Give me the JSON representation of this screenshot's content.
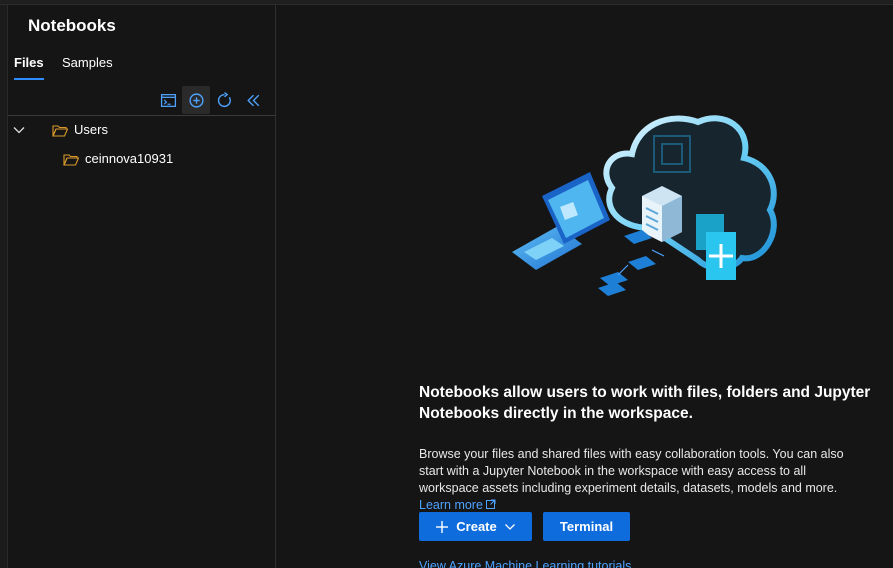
{
  "sidebar": {
    "title": "Notebooks",
    "tabs": [
      {
        "label": "Files",
        "active": true
      },
      {
        "label": "Samples",
        "active": false
      }
    ],
    "toolbar": {
      "icons": [
        "terminal-icon",
        "add-icon",
        "refresh-icon",
        "collapse-icon"
      ]
    },
    "tree": [
      {
        "label": "Users",
        "expanded": true,
        "icon": "folder-icon"
      },
      {
        "label": "ceinnova10931",
        "icon": "folder-icon"
      }
    ]
  },
  "main": {
    "headline": "Notebooks allow users to work with files, folders and Jupyter Notebooks directly in the workspace.",
    "description": "Browse your files and shared files with easy collaboration tools. You can also start with a Jupyter Notebook in the workspace with easy access to all workspace assets including experiment details, datasets, models and more.",
    "learn_more": "Learn more",
    "create_label": "Create",
    "terminal_label": "Terminal",
    "tutorial_link": "View Azure Machine Learning tutorials"
  },
  "colors": {
    "accent": "#0f6cdc",
    "link": "#4da3ff",
    "folder": "#d99a2b",
    "background": "#151515"
  }
}
